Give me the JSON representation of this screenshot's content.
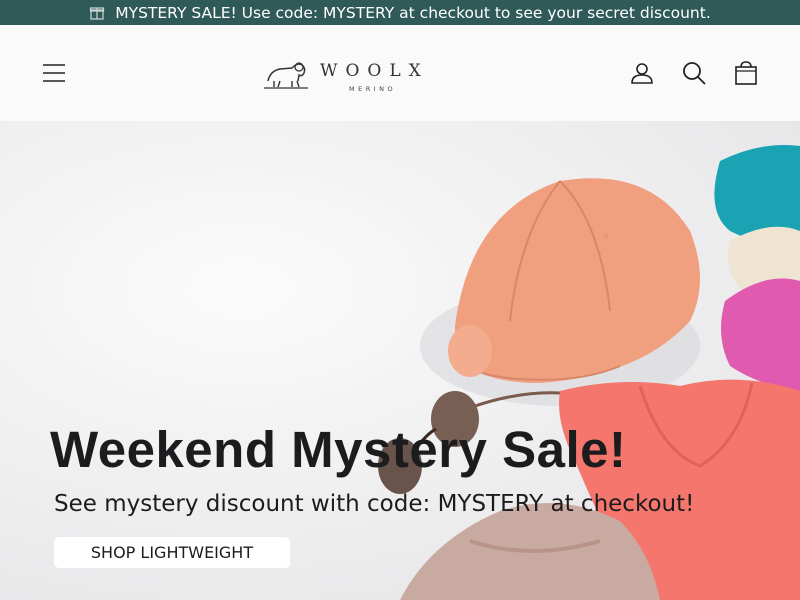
{
  "announcement": {
    "icon": "gift-box-icon",
    "text": "MYSTERY SALE! Use code: MYSTERY at checkout to see your secret discount."
  },
  "header": {
    "menu_icon": "hamburger-menu-icon",
    "logo": {
      "wordmark": "WOOLX",
      "submark": "MERINO",
      "icon": "ram-logo-icon"
    },
    "account_icon": "user-account-icon",
    "search_icon": "search-icon",
    "cart_icon": "shopping-bag-icon"
  },
  "hero": {
    "title": "Weekend Mystery Sale!",
    "subtitle": "See mystery discount with code: MYSTERY at checkout!",
    "cta_label": "SHOP LIGHTWEIGHT",
    "image_subject": "peach-cap-sunglasses-folded-tshirts"
  },
  "colors": {
    "announcement_bg": "#2f5a58",
    "hero_text": "#1c1c1e",
    "cap": "#f0a07e",
    "shirt_coral": "#f5766c",
    "shirt_teal": "#1aa3b2",
    "shirt_pink": "#e05ab0"
  }
}
